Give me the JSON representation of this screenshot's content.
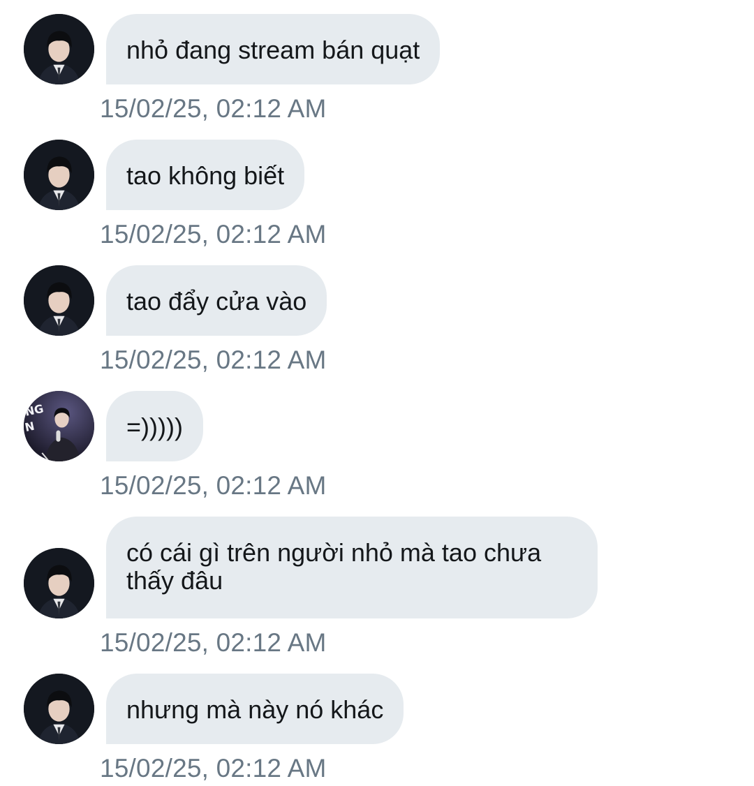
{
  "conversation": {
    "messages": [
      {
        "text": "nhỏ đang stream bán quạt",
        "time": "15/02/25, 02:12 AM",
        "avatar": "avatar-boy-suit-icon"
      },
      {
        "text": "tao không biết",
        "time": "15/02/25, 02:12 AM",
        "avatar": "avatar-boy-suit-icon"
      },
      {
        "text": "tao đẩy cửa vào",
        "time": "15/02/25, 02:12 AM",
        "avatar": "avatar-boy-suit-icon"
      },
      {
        "text": "=)))))",
        "time": "15/02/25, 02:12 AM",
        "avatar": "avatar-stage-singer-icon"
      },
      {
        "text": "có cái gì trên người nhỏ mà tao chưa thấy đâu",
        "time": "15/02/25, 02:12 AM",
        "avatar": "avatar-boy-suit-icon"
      },
      {
        "text": "nhưng mà này nó khác",
        "time": "15/02/25, 02:12 AM",
        "avatar": "avatar-boy-suit-icon"
      }
    ]
  },
  "colors": {
    "bubble_bg": "#e6ebef",
    "text": "#14171a",
    "timestamp": "#687784"
  }
}
